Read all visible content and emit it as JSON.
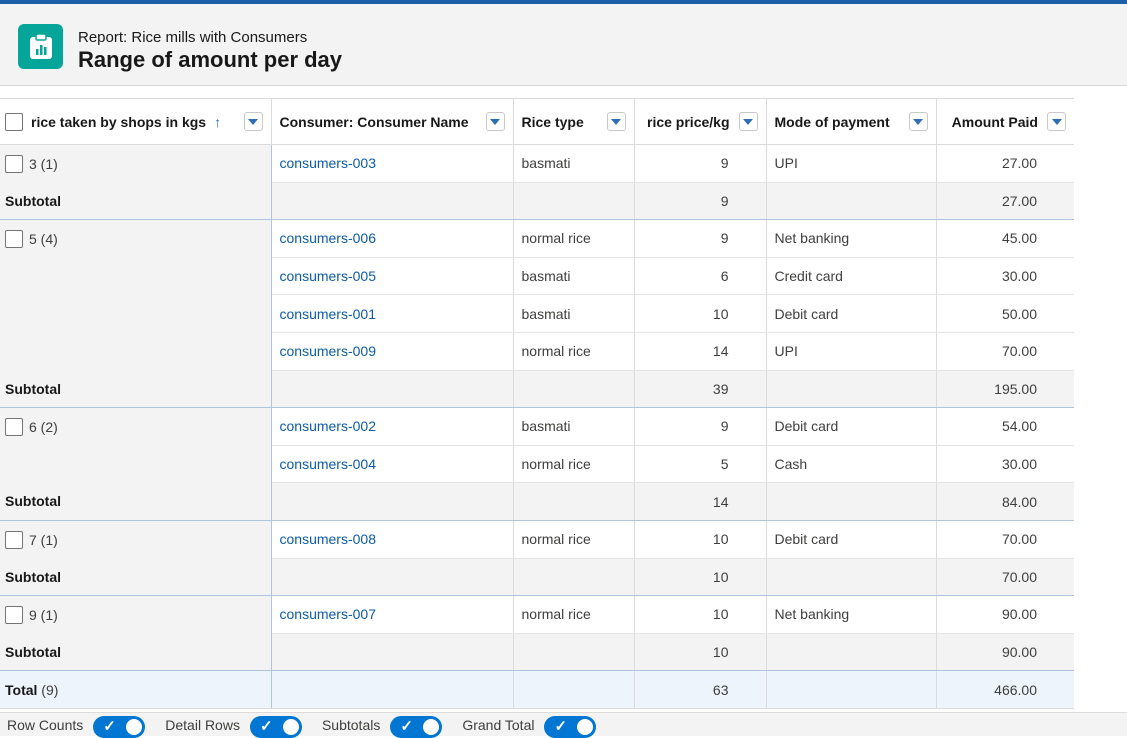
{
  "header": {
    "subtitle": "Report: Rice mills with Consumers",
    "title": "Range of amount per day"
  },
  "columns": [
    {
      "label": "rice taken by shops in kgs",
      "sort": "↑"
    },
    {
      "label": "Consumer: Consumer Name"
    },
    {
      "label": "Rice type"
    },
    {
      "label": "rice price/kg"
    },
    {
      "label": "Mode of payment"
    },
    {
      "label": "Amount Paid"
    }
  ],
  "groups": [
    {
      "label": "3 (1)",
      "rows": [
        {
          "consumer": "consumers-003",
          "rice_type": "basmati",
          "price": "9",
          "mode": "UPI",
          "amount": "27.00"
        }
      ],
      "subtotal": {
        "label": "Subtotal",
        "price": "9",
        "amount": "27.00"
      }
    },
    {
      "label": "5 (4)",
      "rows": [
        {
          "consumer": "consumers-006",
          "rice_type": "normal rice",
          "price": "9",
          "mode": "Net banking",
          "amount": "45.00"
        },
        {
          "consumer": "consumers-005",
          "rice_type": "basmati",
          "price": "6",
          "mode": "Credit card",
          "amount": "30.00"
        },
        {
          "consumer": "consumers-001",
          "rice_type": "basmati",
          "price": "10",
          "mode": "Debit card",
          "amount": "50.00"
        },
        {
          "consumer": "consumers-009",
          "rice_type": "normal rice",
          "price": "14",
          "mode": "UPI",
          "amount": "70.00"
        }
      ],
      "subtotal": {
        "label": "Subtotal",
        "price": "39",
        "amount": "195.00"
      }
    },
    {
      "label": "6 (2)",
      "rows": [
        {
          "consumer": "consumers-002",
          "rice_type": "basmati",
          "price": "9",
          "mode": "Debit card",
          "amount": "54.00"
        },
        {
          "consumer": "consumers-004",
          "rice_type": "normal rice",
          "price": "5",
          "mode": "Cash",
          "amount": "30.00"
        }
      ],
      "subtotal": {
        "label": "Subtotal",
        "price": "14",
        "amount": "84.00"
      }
    },
    {
      "label": "7 (1)",
      "rows": [
        {
          "consumer": "consumers-008",
          "rice_type": "normal rice",
          "price": "10",
          "mode": "Debit card",
          "amount": "70.00"
        }
      ],
      "subtotal": {
        "label": "Subtotal",
        "price": "10",
        "amount": "70.00"
      }
    },
    {
      "label": "9 (1)",
      "rows": [
        {
          "consumer": "consumers-007",
          "rice_type": "normal rice",
          "price": "10",
          "mode": "Net banking",
          "amount": "90.00"
        }
      ],
      "subtotal": {
        "label": "Subtotal",
        "price": "10",
        "amount": "90.00"
      }
    }
  ],
  "total": {
    "label": "Total",
    "count": "(9)",
    "price": "63",
    "amount": "466.00"
  },
  "footer": {
    "toggles": [
      {
        "label": "Row Counts",
        "on": true
      },
      {
        "label": "Detail Rows",
        "on": true
      },
      {
        "label": "Subtotals",
        "on": true
      },
      {
        "label": "Grand Total",
        "on": true
      }
    ]
  },
  "colors": {
    "accent": "#0176d3",
    "link": "#0b5cab",
    "icon_bg": "#06a59a"
  }
}
